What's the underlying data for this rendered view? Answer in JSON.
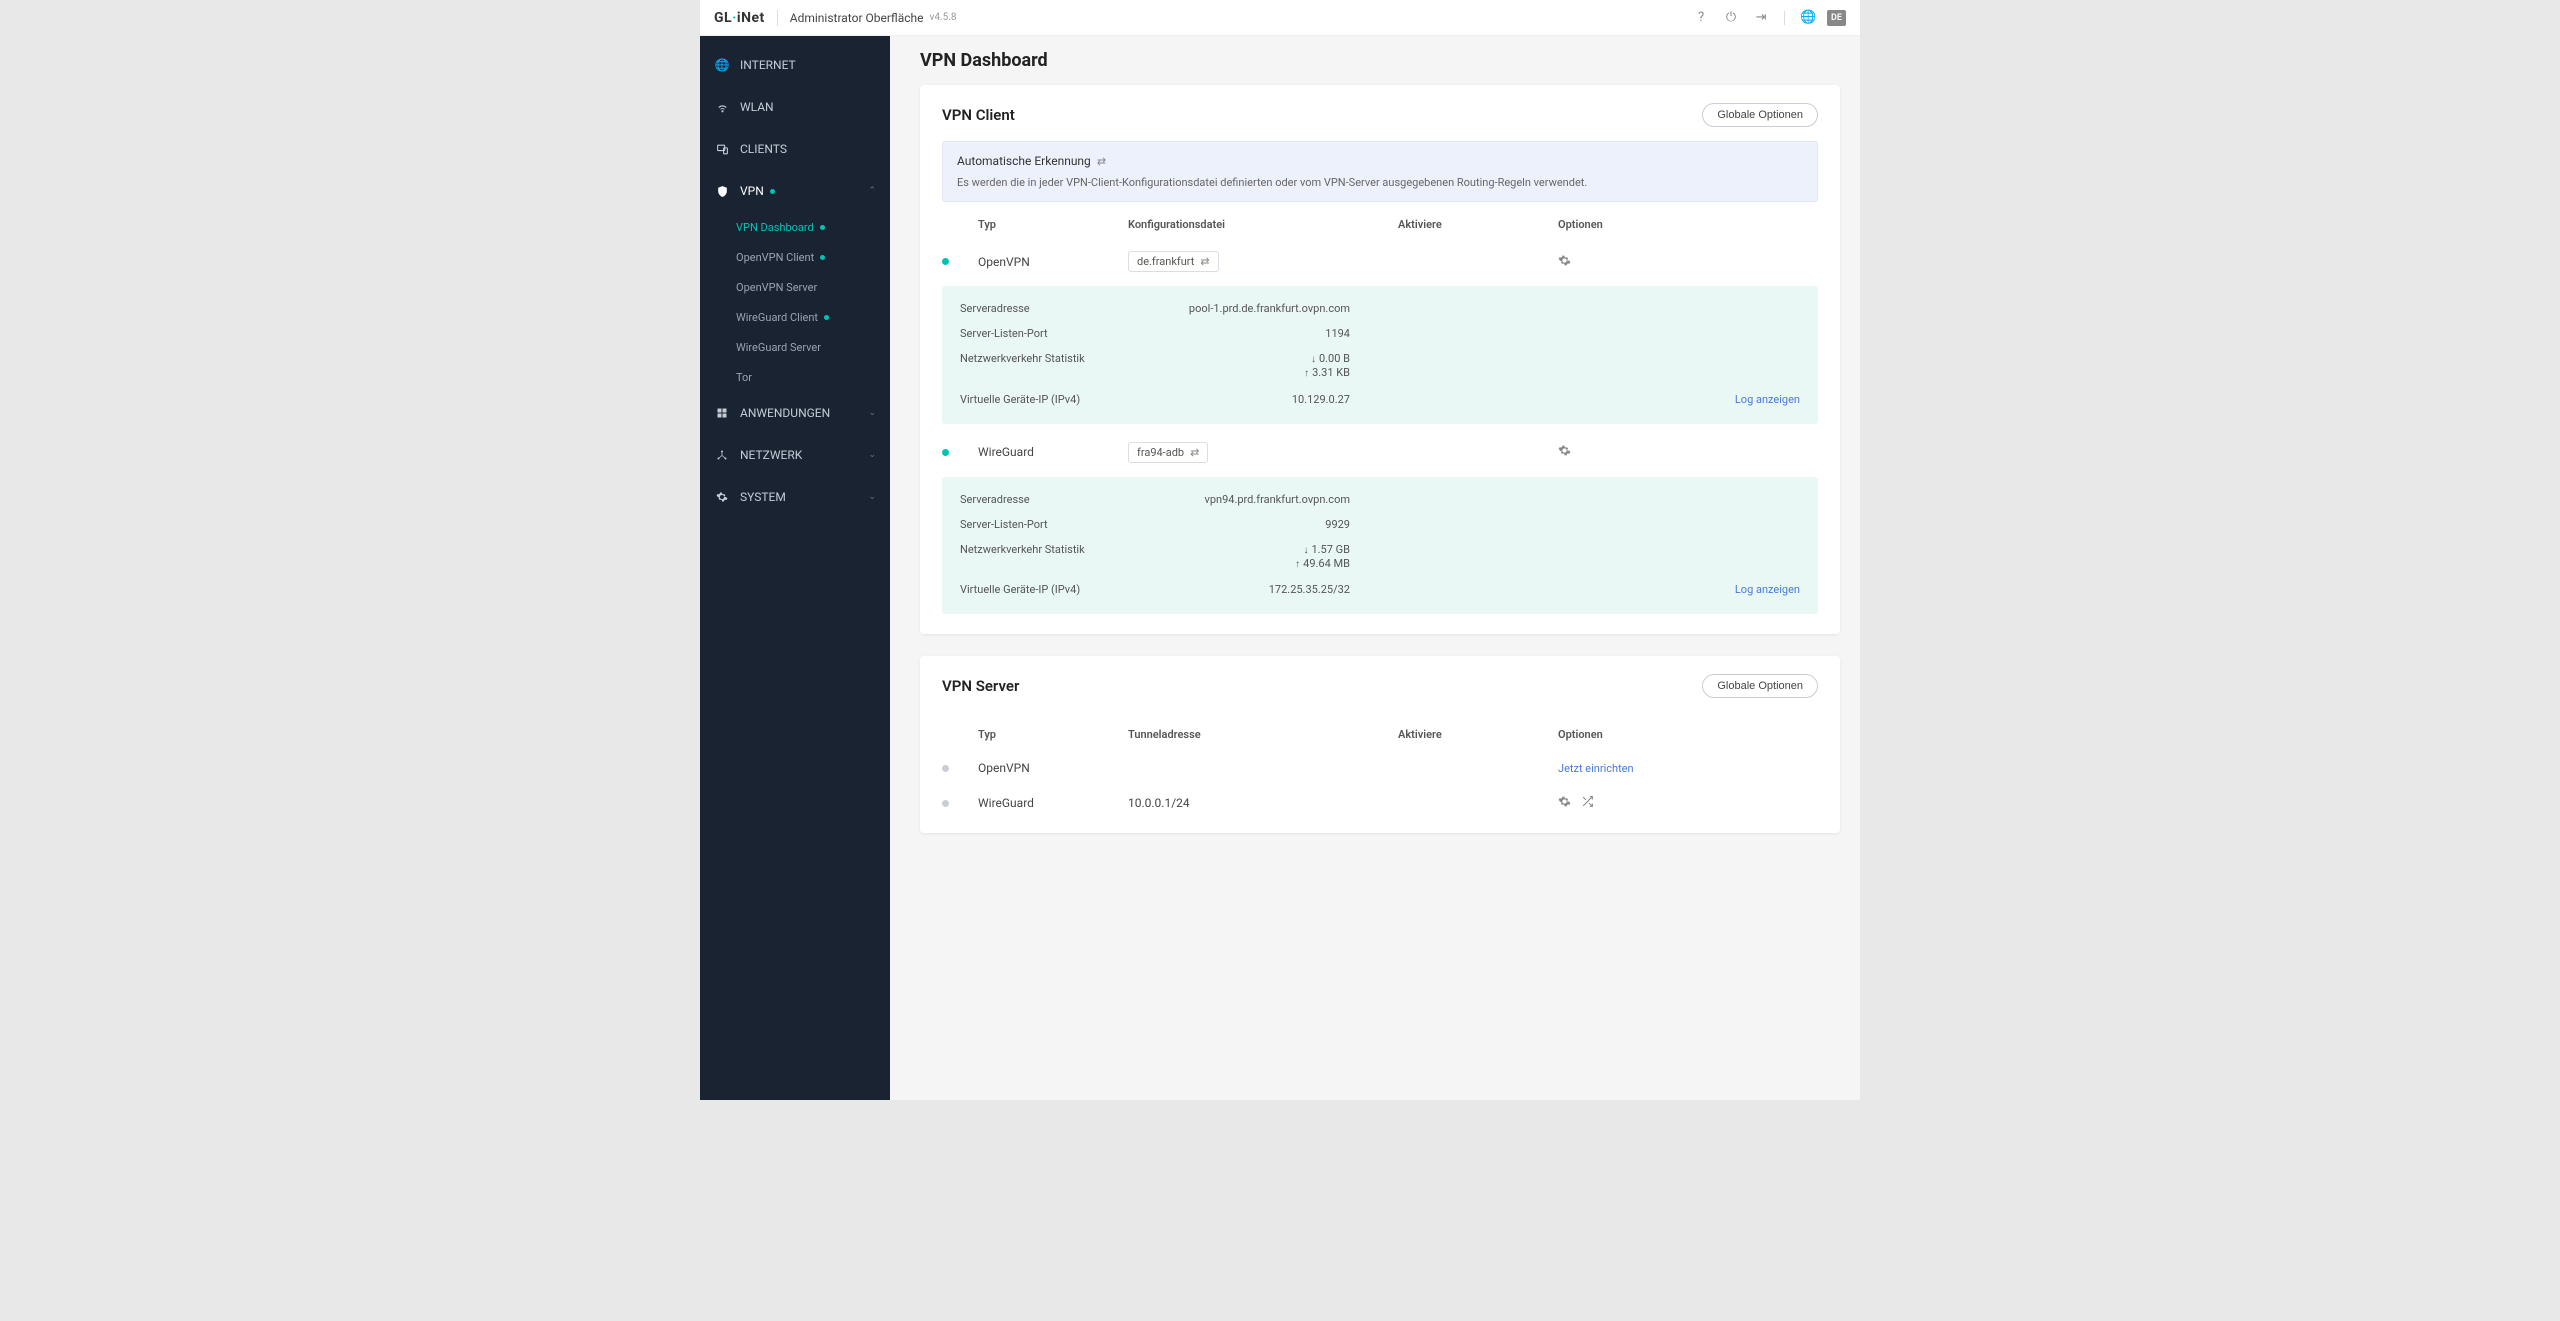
{
  "topbar": {
    "brand": "GL·iNet",
    "title": "Administrator Oberfläche",
    "version": "v4.5.8",
    "lang": "DE"
  },
  "sidebar": {
    "internet": "INTERNET",
    "wlan": "WLAN",
    "clients": "CLIENTS",
    "vpn": "VPN",
    "vpn_items": {
      "dashboard": "VPN Dashboard",
      "ovpn_client": "OpenVPN Client",
      "ovpn_server": "OpenVPN Server",
      "wg_client": "WireGuard Client",
      "wg_server": "WireGuard Server",
      "tor": "Tor"
    },
    "apps": "ANWENDUNGEN",
    "network": "NETZWERK",
    "system": "SYSTEM"
  },
  "page": {
    "title": "VPN Dashboard"
  },
  "client_card": {
    "title": "VPN Client",
    "global_btn": "Globale Optionen",
    "notice_title": "Automatische Erkennung",
    "notice_desc": "Es werden die in jeder VPN-Client-Konfigurationsdatei definierten oder vom VPN-Server ausgegebenen Routing-Regeln verwendet.",
    "cols": {
      "type": "Typ",
      "config": "Konfigurationsdatei",
      "enable": "Aktiviere",
      "options": "Optionen"
    },
    "rows": [
      {
        "type": "OpenVPN",
        "config": "de.frankfurt"
      },
      {
        "type": "WireGuard",
        "config": "fra94-adb"
      }
    ],
    "detail_labels": {
      "addr": "Serveradresse",
      "port": "Server-Listen-Port",
      "traffic": "Netzwerkverkehr Statistik",
      "ip": "Virtuelle Geräte-IP (IPv4)",
      "log": "Log anzeigen"
    },
    "details": [
      {
        "addr": "pool-1.prd.de.frankfurt.ovpn.com",
        "port": "1194",
        "down": "0.00 B",
        "up": "3.31 KB",
        "ip": "10.129.0.27"
      },
      {
        "addr": "vpn94.prd.frankfurt.ovpn.com",
        "port": "9929",
        "down": "1.57 GB",
        "up": "49.64 MB",
        "ip": "172.25.35.25/32"
      }
    ]
  },
  "server_card": {
    "title": "VPN Server",
    "global_btn": "Globale Optionen",
    "cols": {
      "type": "Typ",
      "tunnel": "Tunneladresse",
      "enable": "Aktiviere",
      "options": "Optionen"
    },
    "rows": [
      {
        "type": "OpenVPN",
        "tunnel": "",
        "action": "Jetzt einrichten"
      },
      {
        "type": "WireGuard",
        "tunnel": "10.0.0.1/24"
      }
    ]
  }
}
